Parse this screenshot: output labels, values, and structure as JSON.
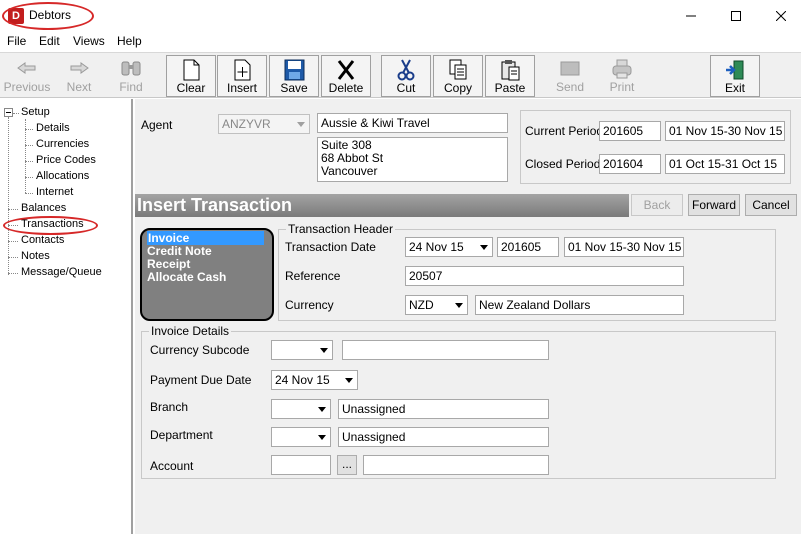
{
  "app": {
    "title": "Debtors",
    "icon_letter": "D"
  },
  "menu": [
    "File",
    "Edit",
    "Views",
    "Help"
  ],
  "toolbar": {
    "previous": "Previous",
    "next": "Next",
    "find": "Find",
    "clear": "Clear",
    "insert": "Insert",
    "save": "Save",
    "delete": "Delete",
    "cut": "Cut",
    "copy": "Copy",
    "paste": "Paste",
    "send": "Send",
    "print": "Print",
    "exit": "Exit"
  },
  "tree": {
    "setup": "Setup",
    "details": "Details",
    "currencies": "Currencies",
    "price_codes": "Price Codes",
    "allocations": "Allocations",
    "internet": "Internet",
    "balances": "Balances",
    "transactions": "Transactions",
    "contacts": "Contacts",
    "notes": "Notes",
    "message_queue": "Message/Queue"
  },
  "agent": {
    "label": "Agent",
    "code": "ANZYVR",
    "name": "Aussie & Kiwi Travel",
    "address_line1": "Suite 308",
    "address_line2": "68 Abbot St",
    "address_line3": "Vancouver"
  },
  "periods": {
    "current_label": "Current Period",
    "current_code": "201605",
    "current_range": "01 Nov 15-30 Nov 15",
    "closed_label": "Closed Period",
    "closed_code": "201604",
    "closed_range": "01 Oct 15-31 Oct 15"
  },
  "insert_panel": {
    "title": "Insert Transaction",
    "back": "Back",
    "forward": "Forward",
    "cancel": "Cancel"
  },
  "transaction_types": [
    "Invoice",
    "Credit Note",
    "Receipt",
    "Allocate Cash"
  ],
  "transaction_header": {
    "title": "Transaction Header",
    "date_label": "Transaction Date",
    "date_value": "24 Nov 15",
    "period_code": "201605",
    "period_range": "01 Nov 15-30 Nov 15",
    "reference_label": "Reference",
    "reference_value": "20507",
    "currency_label": "Currency",
    "currency_code": "NZD",
    "currency_name": "New Zealand Dollars"
  },
  "invoice_details": {
    "title": "Invoice Details",
    "subcode_label": "Currency Subcode",
    "subcode_value": "",
    "subcode_desc": "",
    "payment_due_label": "Payment Due Date",
    "payment_due_value": "24 Nov 15",
    "branch_label": "Branch",
    "branch_value": "",
    "branch_desc": "Unassigned",
    "department_label": "Department",
    "department_value": "",
    "department_desc": "Unassigned",
    "account_label": "Account",
    "account_value": "",
    "account_browse": "...",
    "account_desc": ""
  },
  "colors": {
    "annotation_red": "#d62828",
    "selection_blue": "#3399ff",
    "panel_gray": "#f0f0f0",
    "list_gray": "#808080"
  }
}
